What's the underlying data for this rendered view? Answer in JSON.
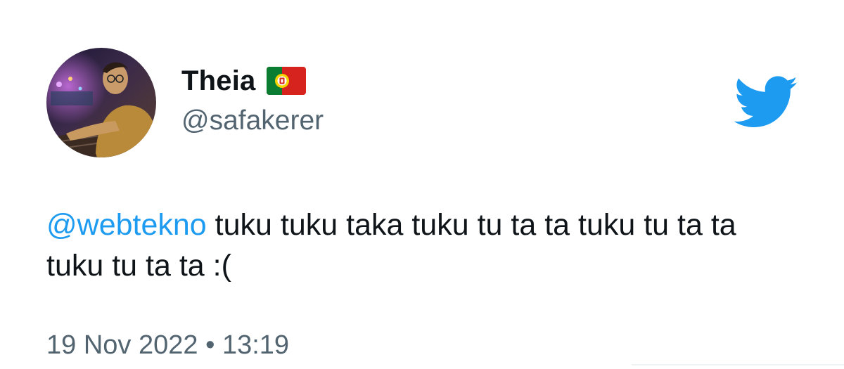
{
  "tweet": {
    "author": {
      "display_name": "Theia",
      "handle": "@safakerer",
      "flag_icon": "portugal-flag-icon",
      "avatar_icon": "profile-photo-avatar"
    },
    "platform_icon": "twitter-bird-icon",
    "brand_color": "#1d9bf0",
    "text": {
      "mention": "@webtekno",
      "body": " tuku tuku taka tuku tu ta ta tuku tu ta ta tuku tu ta ta :("
    },
    "timestamp": {
      "date": "19 Nov 2022",
      "separator": "•",
      "time": "13:19"
    }
  }
}
